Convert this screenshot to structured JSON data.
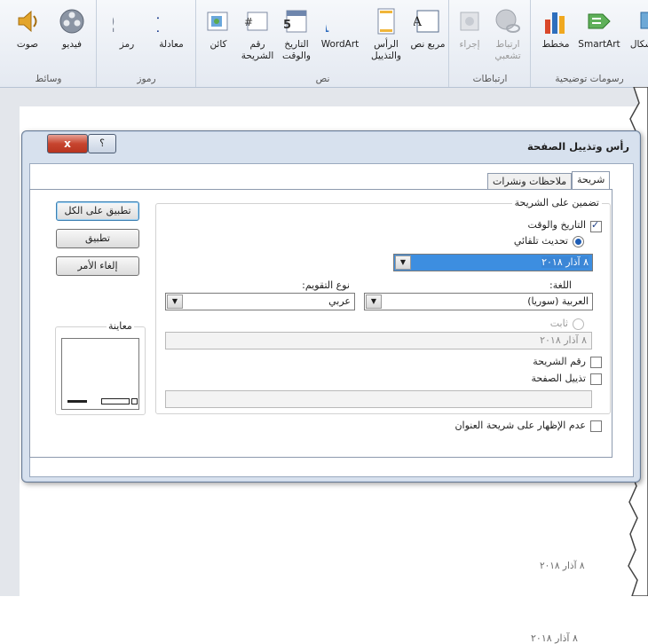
{
  "ribbon": {
    "groups": [
      {
        "name": "رسومات توضيحية",
        "items": [
          "SmartArt",
          "مخطط",
          "أشكال"
        ]
      },
      {
        "name": "ارتباطات",
        "items": [
          "ارتباط تشعبي",
          "إجراء"
        ]
      },
      {
        "name": "نص",
        "items": [
          "مربع نص",
          "الرأس والتذييل",
          "WordArt",
          "التاريخ والوقت",
          "رقم الشريحة",
          "كائن"
        ]
      },
      {
        "name": "رموز",
        "items": [
          "معادلة",
          "رمز"
        ]
      },
      {
        "name": "وسائط",
        "items": [
          "فيديو",
          "صوت"
        ]
      }
    ]
  },
  "dialog": {
    "title": "رأس وتذييل الصفحة",
    "close_label": "x",
    "help_label": "؟",
    "tabs": [
      "شريحة",
      "ملاحظات ونشرات"
    ],
    "buttons": {
      "apply_all": "تطبيق على الكل",
      "apply": "تطبيق",
      "cancel": "إلغاء الأمر"
    },
    "include_label": "تضمين على الشريحة",
    "date_time_label": "التاريخ والوقت",
    "auto_update_label": "تحديث تلقائي",
    "date_value": "٨ آذار ٢٠١٨",
    "language_label": "اللغة:",
    "language_value": "العربية (سوريا)",
    "calendar_label": "نوع التقويم:",
    "calendar_value": "عربي",
    "fixed_label": "ثابت",
    "fixed_value": "٨ آذار ٢٠١٨",
    "slide_number_label": "رقم الشريحة",
    "footer_label": "تذييل الصفحة",
    "preview_label": "معاينة",
    "dont_show_title_label": "عدم الإظهار على شريحة العنوان"
  },
  "slide": {
    "footer_date": "٨ آذار ٢٠١٨"
  },
  "colors": {
    "accent": "#3d8ee0",
    "close": "#c7452f"
  }
}
